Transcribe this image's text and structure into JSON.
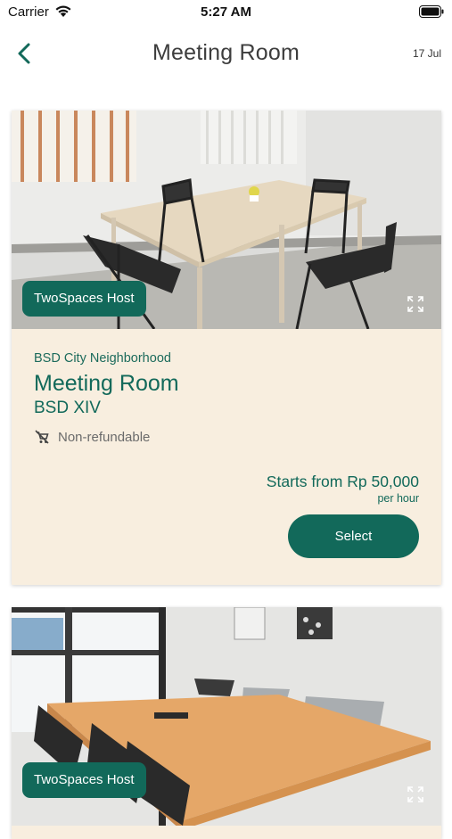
{
  "status_bar": {
    "carrier": "Carrier",
    "time": "5:27 AM"
  },
  "nav": {
    "title": "Meeting Room",
    "date": "17 Jul"
  },
  "listings": [
    {
      "host": "TwoSpaces Host",
      "neighborhood": "BSD City Neighborhood",
      "name": "Meeting Room",
      "subtitle": "BSD XIV",
      "policy": "Non-refundable",
      "price": "Starts from Rp 50,000",
      "unit": "per hour",
      "select_label": "Select"
    },
    {
      "host": "TwoSpaces Host"
    }
  ],
  "colors": {
    "primary": "#12695a",
    "card_background": "#f8eedf",
    "badge_text": "#ffffff"
  },
  "icons": [
    "wifi-icon",
    "battery-icon",
    "back-chevron-icon",
    "expand-icon",
    "no-cart-icon"
  ]
}
